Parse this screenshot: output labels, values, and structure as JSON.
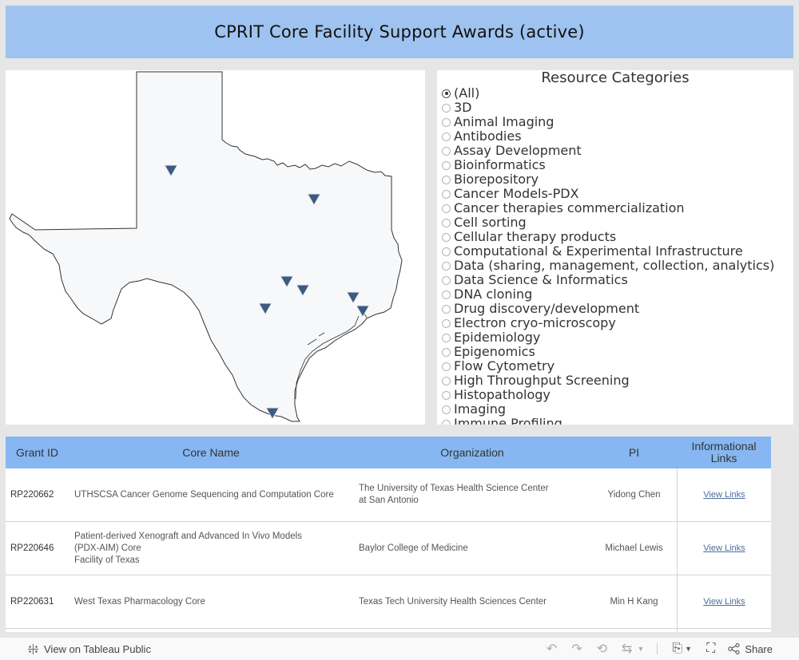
{
  "header": {
    "title": "CPRIT Core Facility Support Awards (active)"
  },
  "map": {
    "marker_color": "#3d5a80",
    "markers": [
      {
        "name": "lubbock-marker"
      },
      {
        "name": "dallas-marker"
      },
      {
        "name": "austin-marker"
      },
      {
        "name": "bastrop-marker"
      },
      {
        "name": "san-antonio-marker"
      },
      {
        "name": "houston-marker-1"
      },
      {
        "name": "houston-marker-2"
      },
      {
        "name": "rio-grande-valley-marker"
      }
    ]
  },
  "filter": {
    "title": "Resource Categories",
    "selected": "(All)",
    "options": [
      "(All)",
      "3D",
      "Animal Imaging",
      "Antibodies",
      "Assay Development",
      "Bioinformatics",
      "Biorepository",
      "Cancer Models-PDX",
      "Cancer therapies commercialization",
      "Cell sorting",
      "Cellular therapy products",
      "Computational & Experimental Infrastructure",
      "Data (sharing, management, collection, analytics)",
      "Data Science & Informatics",
      "DNA cloning",
      "Drug discovery/development",
      "Electron cryo-microscopy",
      "Epidemiology",
      "Epigenomics",
      "Flow Cytometry",
      "High Throughput Screening",
      "Histopathology",
      "Imaging",
      "Immune Profiling"
    ]
  },
  "table": {
    "headers": {
      "grant": "Grant ID",
      "core": "Core Name",
      "org": "Organization",
      "pi": "PI",
      "links": "Informational Links"
    },
    "rows": [
      {
        "grant": "RP220662",
        "core": [
          "UTHSCSA Cancer Genome Sequencing and Computation Core"
        ],
        "org": [
          "The University of Texas Health Science Center",
          "at San Antonio"
        ],
        "pi": "Yidong Chen",
        "links": "View Links"
      },
      {
        "grant": "RP220646",
        "core": [
          "Patient-derived Xenograft and Advanced In Vivo Models",
          "(PDX-AIM) Core",
          "Facility of Texas"
        ],
        "org": [
          "Baylor College of Medicine"
        ],
        "pi": "Michael Lewis",
        "links": "View Links"
      },
      {
        "grant": "RP220631",
        "core": [
          "West Texas Pharmacology Core"
        ],
        "org": [
          "Texas Tech University Health Sciences Center"
        ],
        "pi": "Min H Kang",
        "links": "View Links"
      }
    ]
  },
  "footer": {
    "view_on_label": "View on Tableau Public",
    "share_label": "Share"
  }
}
